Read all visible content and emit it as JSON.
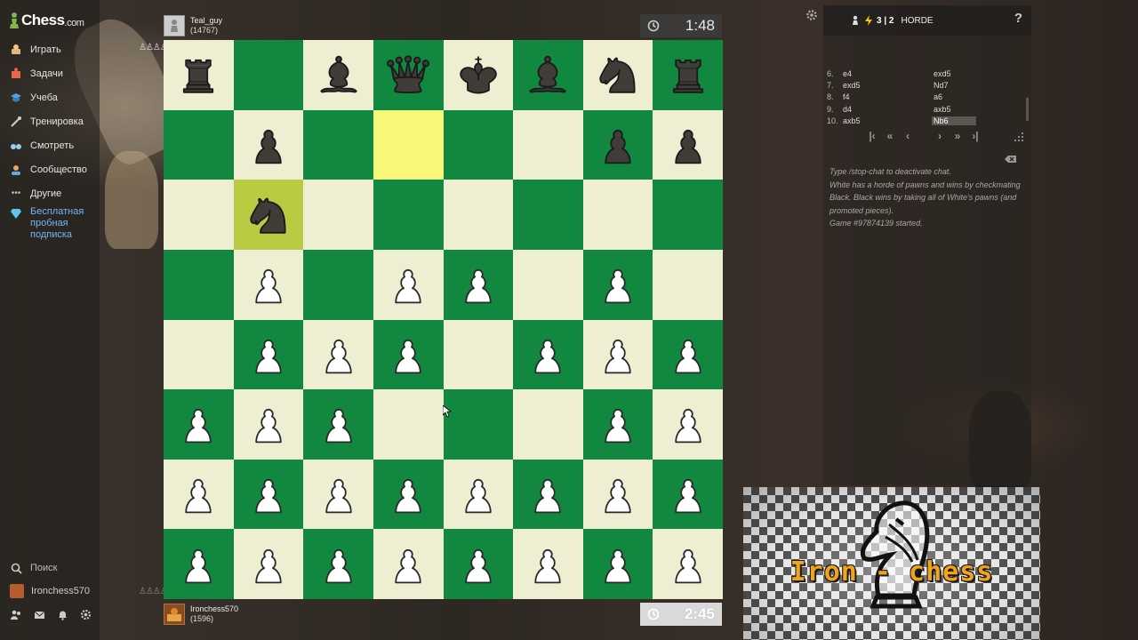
{
  "app": {
    "logo": "Chess",
    "logo_tld": ".com"
  },
  "sidebar": {
    "items": [
      {
        "label": "Играть",
        "icon": "play-icon"
      },
      {
        "label": "Задачи",
        "icon": "puzzle-icon"
      },
      {
        "label": "Учеба",
        "icon": "learn-icon"
      },
      {
        "label": "Тренировка",
        "icon": "practice-icon"
      },
      {
        "label": "Смотреть",
        "icon": "watch-icon"
      },
      {
        "label": "Сообщество",
        "icon": "community-icon"
      },
      {
        "label": "Другие",
        "icon": "more-icon"
      }
    ],
    "promo": "Бесплатная пробная подписка",
    "search": "Поиск",
    "user": "Ironchess570"
  },
  "players": {
    "top": {
      "name": "Teal_guy",
      "rating": "(14767)",
      "clock": "1:48"
    },
    "bottom": {
      "name": "Ironchess570",
      "rating": "(1596)",
      "clock": "2:45"
    }
  },
  "board": {
    "rows": [
      [
        "br",
        "",
        "bb",
        "bq",
        "bk",
        "bb",
        "bn",
        "br"
      ],
      [
        "",
        "bp",
        "",
        "",
        "",
        "",
        "bp",
        "bp"
      ],
      [
        "",
        "bn",
        "",
        "",
        "",
        "",
        "",
        ""
      ],
      [
        "",
        "wp",
        "",
        "wp",
        "wp",
        "",
        "wp",
        ""
      ],
      [
        "",
        "wp",
        "wp",
        "wp",
        "",
        "wp",
        "wp",
        "wp"
      ],
      [
        "wp",
        "wp",
        "wp",
        "",
        "",
        "",
        "wp",
        "wp"
      ],
      [
        "wp",
        "wp",
        "wp",
        "wp",
        "wp",
        "wp",
        "wp",
        "wp"
      ],
      [
        "wp",
        "wp",
        "wp",
        "wp",
        "wp",
        "wp",
        "wp",
        "wp"
      ]
    ],
    "highlight": [
      [
        1,
        3
      ],
      [
        2,
        1
      ]
    ]
  },
  "game": {
    "time_control": "3 | 2",
    "variant": "HORDE",
    "help": "?",
    "moves": [
      {
        "no": "6.",
        "white": "e4",
        "black": "exd5"
      },
      {
        "no": "7.",
        "white": "exd5",
        "black": "Nd7"
      },
      {
        "no": "8.",
        "white": "f4",
        "black": "a6"
      },
      {
        "no": "9.",
        "white": "d4",
        "black": "axb5"
      },
      {
        "no": "10.",
        "white": "axb5",
        "black": "Nb6"
      }
    ],
    "nav": [
      "|‹",
      "«",
      "‹",
      "›",
      "»",
      "›|"
    ],
    "chat": [
      "Type /stop-chat to deactivate chat.",
      "White has a horde of pawns and wins by checkmating Black. Black wins by taking all of White's pawns (and promoted pieces).",
      "Game #97874139 started."
    ]
  },
  "overlay": {
    "text": "Iron - chess"
  }
}
